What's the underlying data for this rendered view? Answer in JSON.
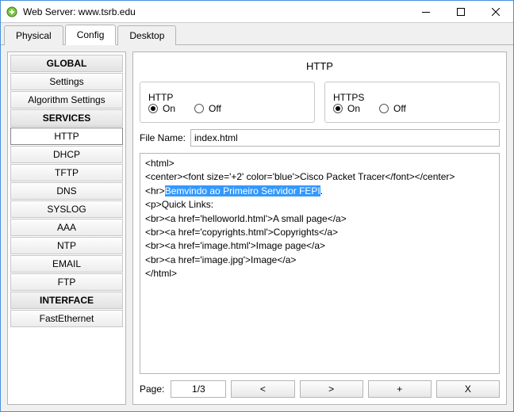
{
  "window": {
    "title": "Web Server: www.tsrb.edu"
  },
  "tabs": {
    "physical": "Physical",
    "config": "Config",
    "desktop": "Desktop",
    "active": "config"
  },
  "sidebar": {
    "global": {
      "header": "GLOBAL",
      "settings": "Settings",
      "algo": "Algorithm Settings"
    },
    "services": {
      "header": "SERVICES",
      "http": "HTTP",
      "dhcp": "DHCP",
      "tftp": "TFTP",
      "dns": "DNS",
      "syslog": "SYSLOG",
      "aaa": "AAA",
      "ntp": "NTP",
      "email": "EMAIL",
      "ftp": "FTP"
    },
    "interface": {
      "header": "INTERFACE",
      "fe": "FastEthernet"
    }
  },
  "pane": {
    "title": "HTTP",
    "http": {
      "legend": "HTTP",
      "on": "On",
      "off": "Off",
      "selected": "on"
    },
    "https": {
      "legend": "HTTPS",
      "on": "On",
      "off": "Off",
      "selected": "on"
    },
    "filename_label": "File Name:",
    "filename_value": "index.html",
    "editor": {
      "l1": "<html>",
      "l2": "<center><font size='+2' color='blue'>Cisco Packet Tracer</font></center>",
      "l3a": "<hr>",
      "l3sel": "Bemvindo ao Primeiro Servidor FEPI",
      "l3b": ".",
      "l4": "<p>Quick Links:",
      "l5": "<br><a href='helloworld.html'>A small page</a>",
      "l6": "<br><a href='copyrights.html'>Copyrights</a>",
      "l7": "<br><a href='image.html'>Image page</a>",
      "l8": "<br><a href='image.jpg'>Image</a>",
      "l9": "</html>"
    },
    "pager": {
      "label": "Page:",
      "count": "1/3",
      "prev": "<",
      "next": ">",
      "add": "+",
      "del": "X"
    }
  }
}
